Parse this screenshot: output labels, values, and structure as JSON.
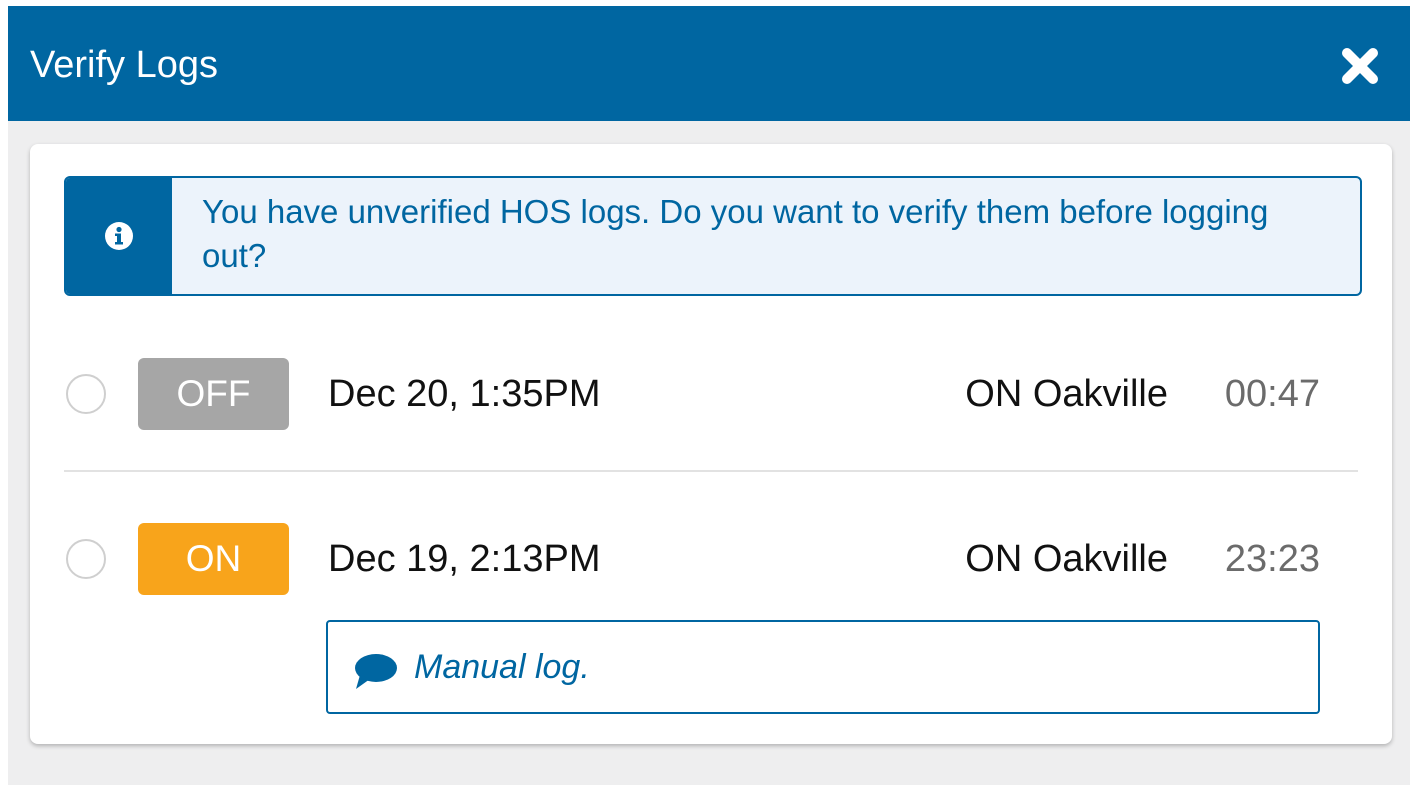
{
  "header": {
    "title": "Verify Logs",
    "close_icon": "close-x-icon"
  },
  "alert": {
    "icon": "info-icon",
    "message": "You have unverified HOS logs. Do you want to verify them before logging out?"
  },
  "logs": [
    {
      "status": "OFF",
      "status_color": "#a6a6a6",
      "date": "Dec 20, 1:35PM",
      "location": "ON Oakville",
      "duration": "00:47",
      "selected": false
    },
    {
      "status": "ON",
      "status_color": "#f8a41b",
      "date": "Dec 19, 2:13PM",
      "location": "ON Oakville",
      "duration": "23:23",
      "selected": false,
      "note": {
        "icon": "comment-icon",
        "text": "Manual log."
      }
    }
  ],
  "colors": {
    "brand": "#0066a1",
    "alert_bg": "#ecf3fb",
    "page_bg": "#eeeeef"
  }
}
